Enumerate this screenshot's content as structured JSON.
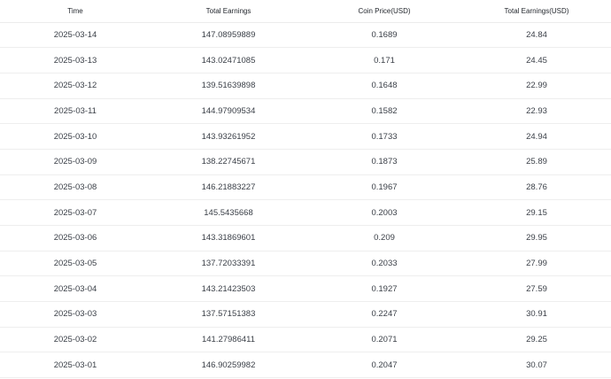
{
  "table": {
    "headers": {
      "time": "Time",
      "total_earnings": "Total Earnings",
      "coin_price": "Coin Price(USD)",
      "total_earnings_usd": "Total Earnings(USD)"
    },
    "rows": [
      {
        "time": "2025-03-14",
        "total_earnings": "147.08959889",
        "coin_price": "0.1689",
        "total_earnings_usd": "24.84"
      },
      {
        "time": "2025-03-13",
        "total_earnings": "143.02471085",
        "coin_price": "0.171",
        "total_earnings_usd": "24.45"
      },
      {
        "time": "2025-03-12",
        "total_earnings": "139.51639898",
        "coin_price": "0.1648",
        "total_earnings_usd": "22.99"
      },
      {
        "time": "2025-03-11",
        "total_earnings": "144.97909534",
        "coin_price": "0.1582",
        "total_earnings_usd": "22.93"
      },
      {
        "time": "2025-03-10",
        "total_earnings": "143.93261952",
        "coin_price": "0.1733",
        "total_earnings_usd": "24.94"
      },
      {
        "time": "2025-03-09",
        "total_earnings": "138.22745671",
        "coin_price": "0.1873",
        "total_earnings_usd": "25.89"
      },
      {
        "time": "2025-03-08",
        "total_earnings": "146.21883227",
        "coin_price": "0.1967",
        "total_earnings_usd": "28.76"
      },
      {
        "time": "2025-03-07",
        "total_earnings": "145.5435668",
        "coin_price": "0.2003",
        "total_earnings_usd": "29.15"
      },
      {
        "time": "2025-03-06",
        "total_earnings": "143.31869601",
        "coin_price": "0.209",
        "total_earnings_usd": "29.95"
      },
      {
        "time": "2025-03-05",
        "total_earnings": "137.72033391",
        "coin_price": "0.2033",
        "total_earnings_usd": "27.99"
      },
      {
        "time": "2025-03-04",
        "total_earnings": "143.21423503",
        "coin_price": "0.1927",
        "total_earnings_usd": "27.59"
      },
      {
        "time": "2025-03-03",
        "total_earnings": "137.57151383",
        "coin_price": "0.2247",
        "total_earnings_usd": "30.91"
      },
      {
        "time": "2025-03-02",
        "total_earnings": "141.27986411",
        "coin_price": "0.2071",
        "total_earnings_usd": "29.25"
      },
      {
        "time": "2025-03-01",
        "total_earnings": "146.90259982",
        "coin_price": "0.2047",
        "total_earnings_usd": "30.07"
      }
    ]
  }
}
